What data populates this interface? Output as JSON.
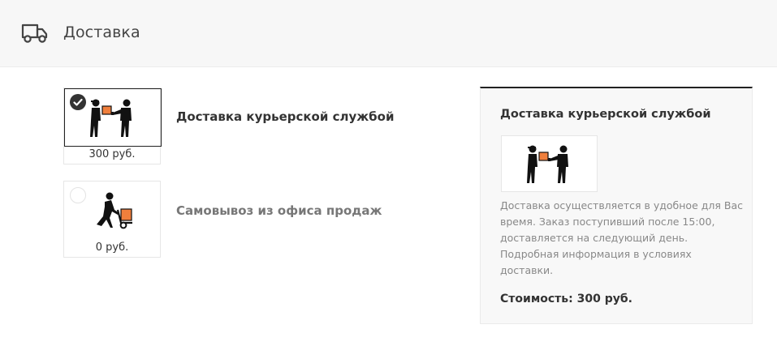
{
  "header": {
    "icon": "truck-icon",
    "title": "Доставка"
  },
  "options": [
    {
      "icon": "courier-handover-icon",
      "price": "300 руб.",
      "label": "Доставка курьерской службой",
      "selected": true
    },
    {
      "icon": "pickup-cart-icon",
      "price": "0 руб.",
      "label": "Самовывоз из офиса продаж",
      "selected": false
    }
  ],
  "details": {
    "title": "Доставка курьерской службой",
    "image_icon": "courier-handover-icon",
    "description": "Доставка осуществляется в удобное для Вас время. Заказ поступивший после 15:00, доставляется на следующий день. Подробная информация в условиях доставки.",
    "cost": "Стоимость: 300 руб."
  },
  "colors": {
    "accent_box": "#f07f3c",
    "figure": "#111111",
    "check_bg": "#333333"
  }
}
